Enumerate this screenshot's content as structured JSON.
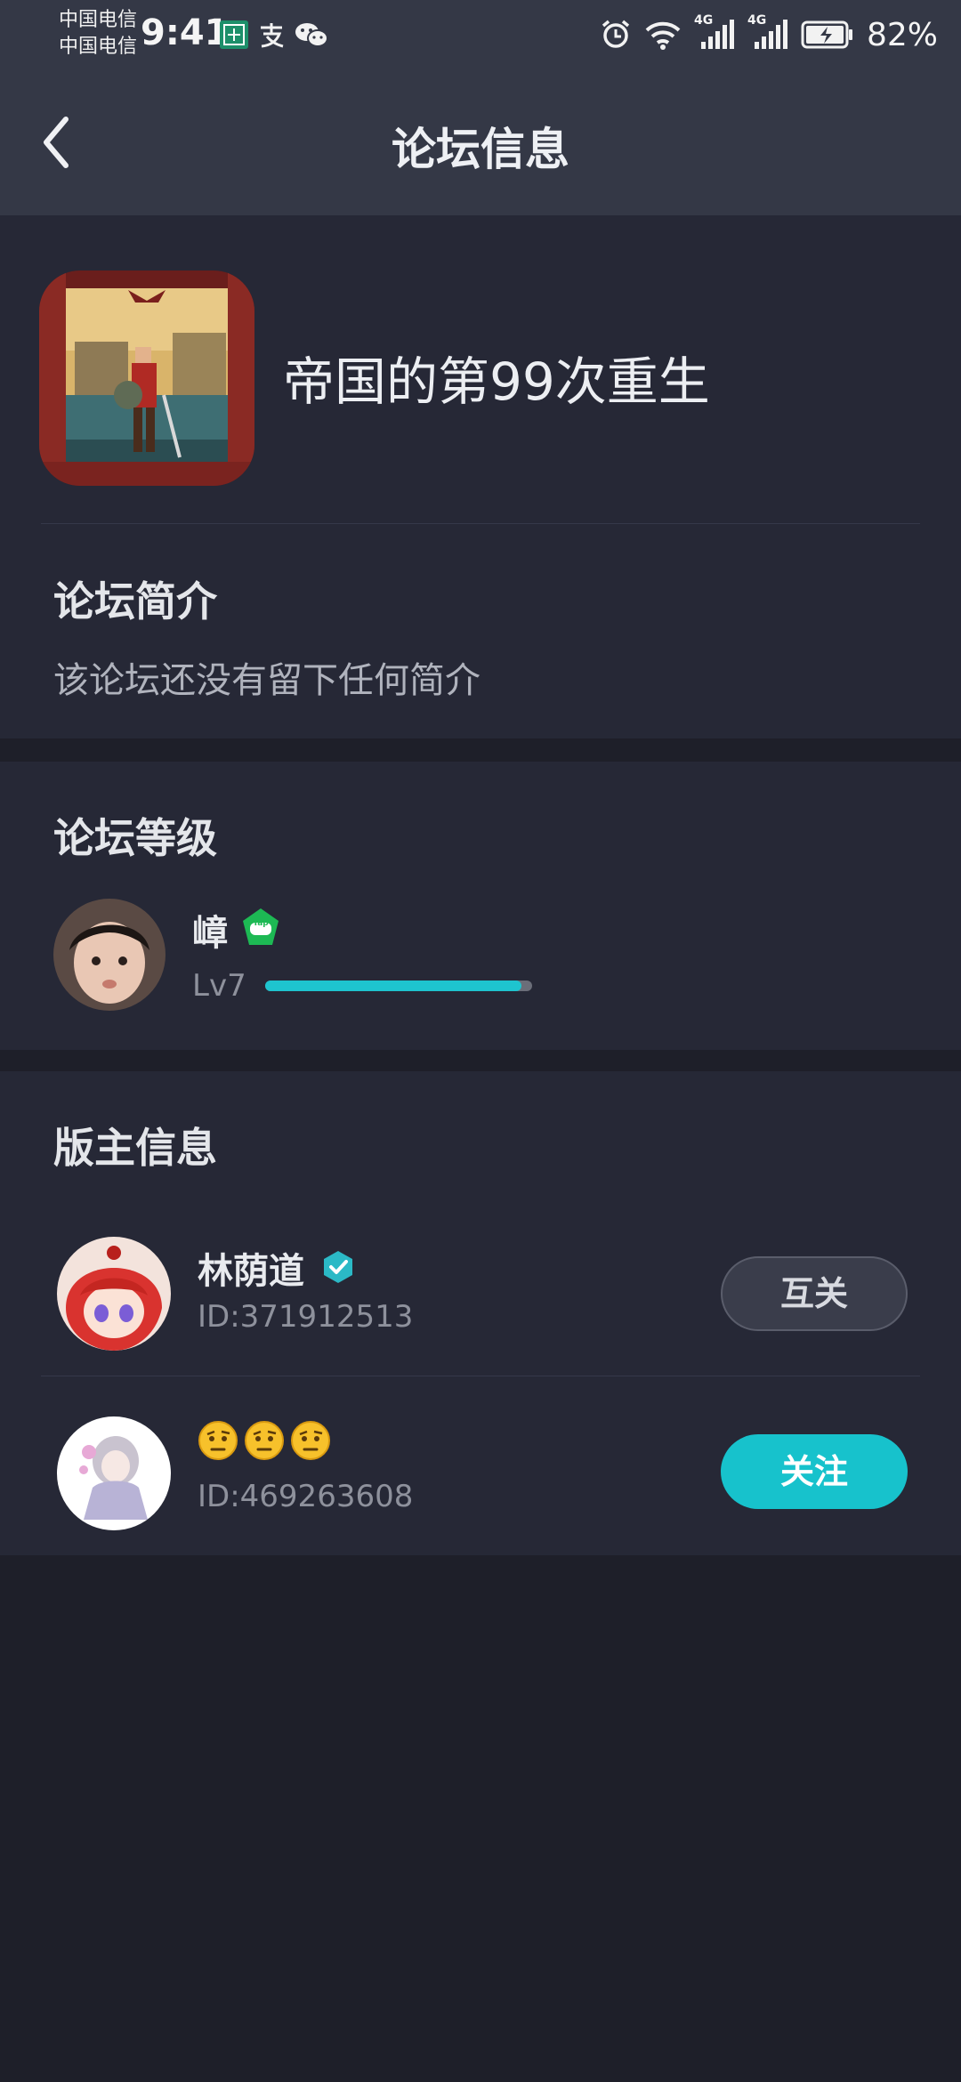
{
  "status_bar": {
    "carrier_1": "中国电信",
    "carrier_2": "中国电信",
    "time": "9:41",
    "network_1": "4G",
    "network_2": "4G",
    "battery": "82%"
  },
  "header": {
    "title": "论坛信息",
    "back_icon": "chevron-left-icon"
  },
  "forum": {
    "name": "帝国的第99次重生"
  },
  "intro": {
    "title": "论坛简介",
    "text": "该论坛还没有留下任何简介"
  },
  "level": {
    "title": "论坛等级",
    "user_name": "嶂",
    "badge_text": "Tap",
    "level_label": "Lv7",
    "progress": 0.96
  },
  "moderators": {
    "title": "版主信息",
    "items": [
      {
        "name": "林荫道",
        "id": "ID:371912513",
        "button": "互关",
        "verified": true
      },
      {
        "name": "🤨🤨🤨",
        "id": "ID:469263608",
        "button": "关注",
        "verified": false
      }
    ]
  },
  "colors": {
    "accent": "#17c2cc",
    "background": "#1e1f29",
    "card": "#262836",
    "header": "#343846"
  }
}
